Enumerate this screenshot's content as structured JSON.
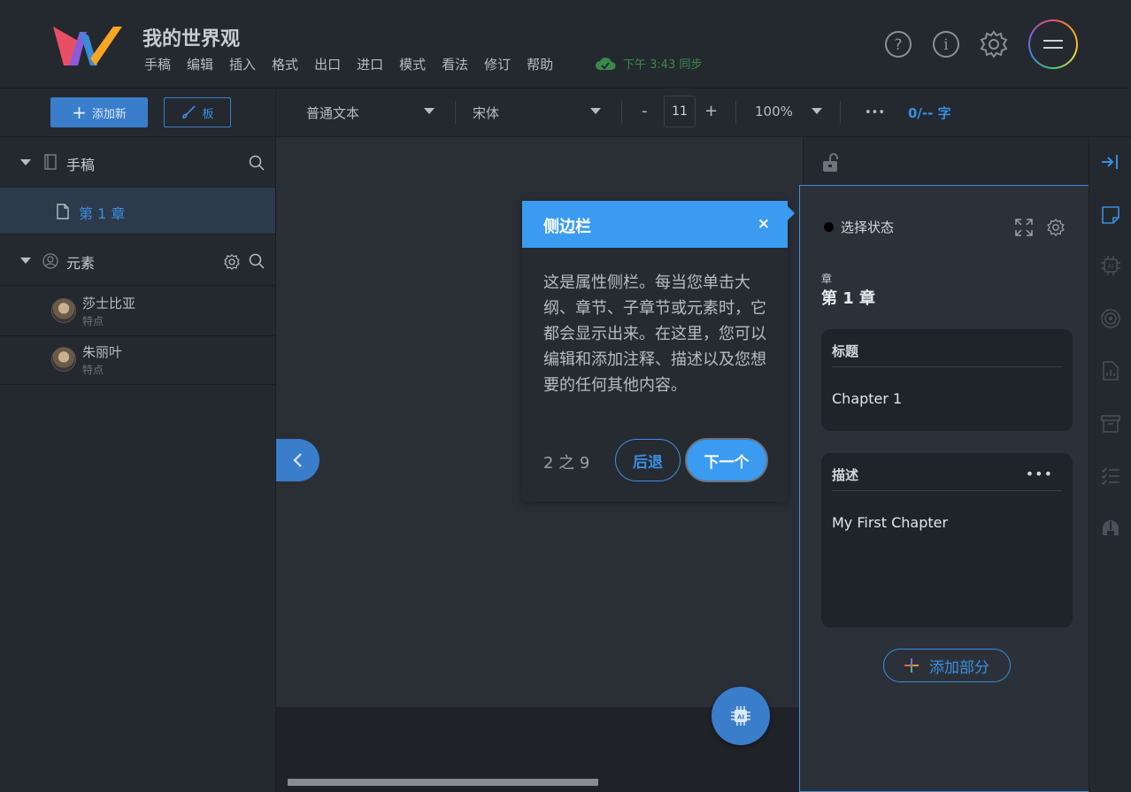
{
  "app": {
    "title": "我的世界观",
    "menu": [
      "手稿",
      "编辑",
      "插入",
      "格式",
      "出口",
      "进口",
      "模式",
      "看法",
      "修订",
      "帮助"
    ],
    "sync_text": "下午 3:43 同步"
  },
  "toolbar": {
    "add_new_label": "添加新",
    "board_label": "板",
    "paragraph_style": "普通文本",
    "font_name": "宋体",
    "font_size": "11",
    "minus": "-",
    "plus": "+",
    "zoom": "100%",
    "more": "•••",
    "word_count": "0/-- 字"
  },
  "sidebar": {
    "manuscript_label": "手稿",
    "chapter_item": "第 1 章",
    "elements_label": "元素",
    "elements": [
      {
        "name": "莎士比亚",
        "sub": "特点"
      },
      {
        "name": "朱丽叶",
        "sub": "特点"
      }
    ]
  },
  "tour": {
    "title": "侧边栏",
    "close": "×",
    "body": "这是属性侧栏。每当您单击大纲、章节、子章节或元素时，它都会显示出来。在这里，您可以编辑和添加注释、描述以及您想要的任何其他内容。",
    "counter": "2 之 9",
    "back_label": "后退",
    "next_label": "下一个"
  },
  "props": {
    "status": "选择状态",
    "type_label": "章",
    "name": "第 1 章",
    "title_card_label": "标题",
    "title_value": "Chapter 1",
    "desc_card_label": "描述",
    "desc_more": "•••",
    "desc_value": "My First Chapter",
    "add_section_label": "添加部分"
  },
  "colors": {
    "accent": "#3a8ee0",
    "tour_header": "#3b9bf1",
    "sync_green": "#3a8a4a"
  }
}
